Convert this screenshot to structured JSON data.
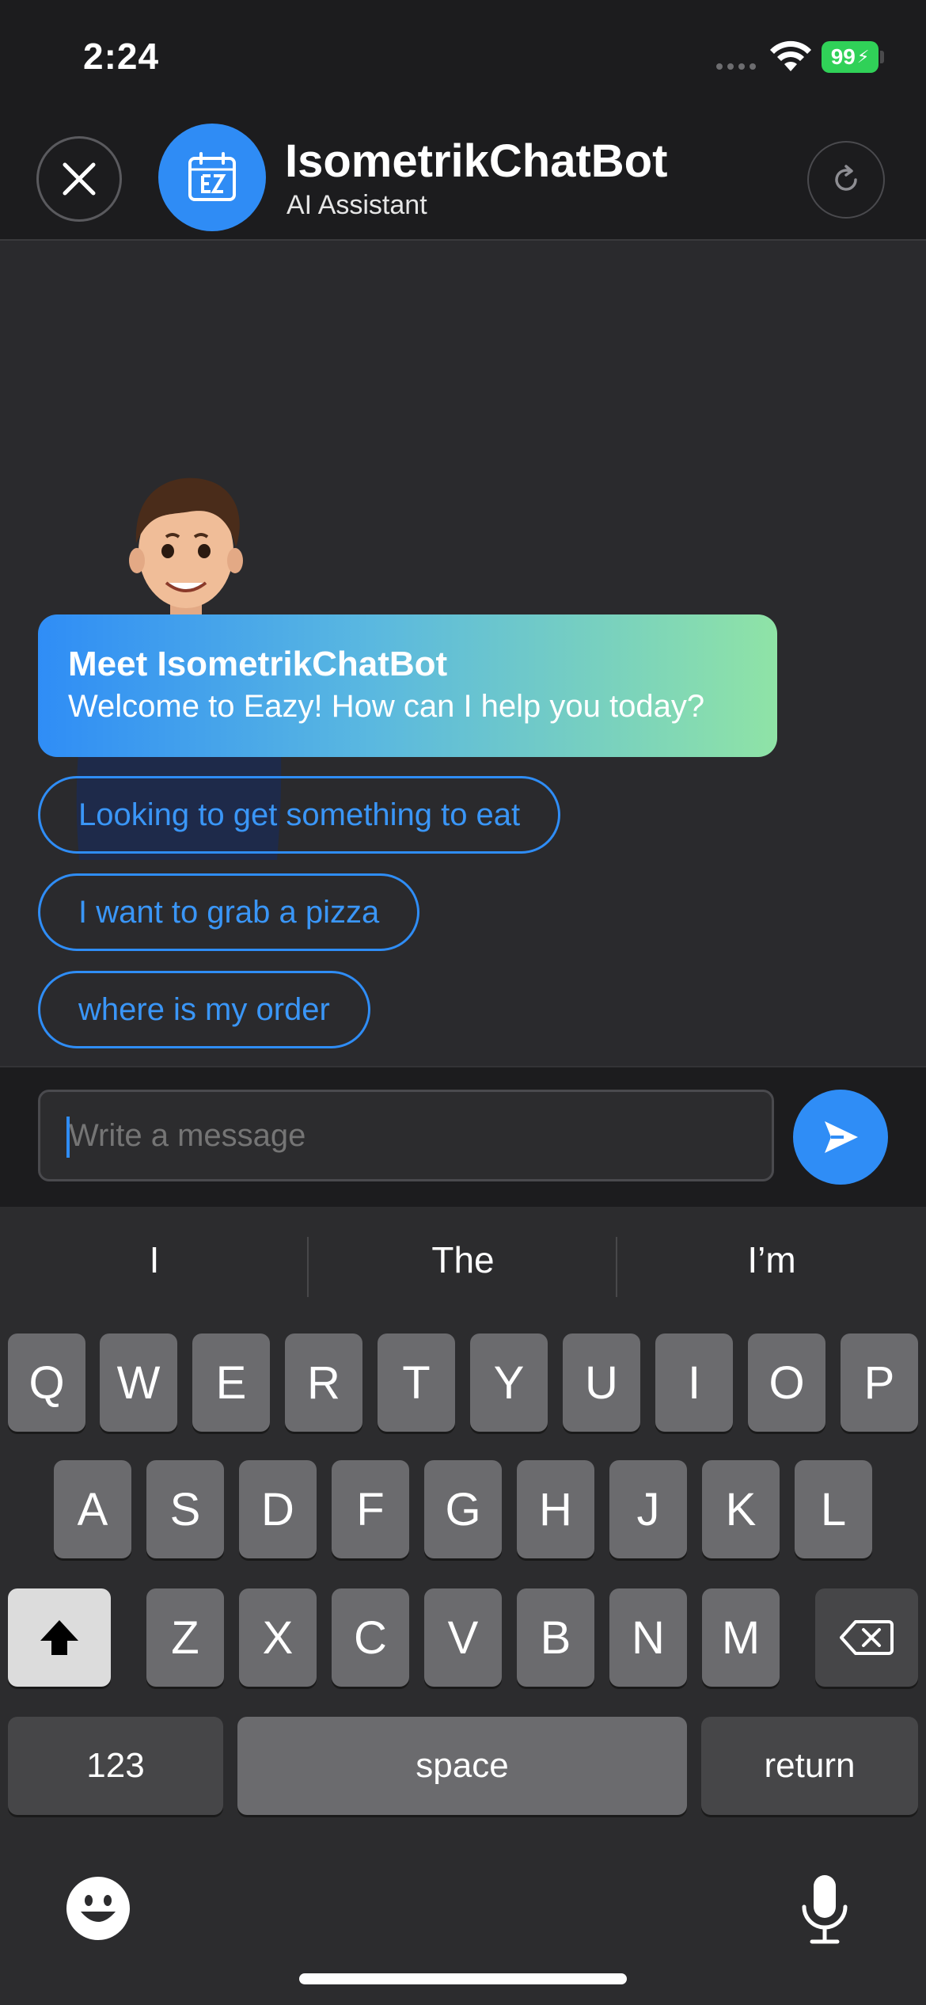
{
  "status": {
    "time": "2:24",
    "battery": "99"
  },
  "header": {
    "bot_name": "IsometrikChatBot",
    "bot_subtitle": "AI Assistant",
    "avatar_icon": "calendar-ez-icon"
  },
  "chat": {
    "welcome_title": "Meet IsometrikChatBot",
    "welcome_text": "Welcome to Eazy! How can I help you today?",
    "suggestions": [
      "Looking to get something to eat",
      "I want to grab a pizza",
      "where is my order"
    ]
  },
  "composer": {
    "placeholder": "Write a message"
  },
  "keyboard": {
    "predictions": [
      "I",
      "The",
      "I’m"
    ],
    "row1": [
      "Q",
      "W",
      "E",
      "R",
      "T",
      "Y",
      "U",
      "I",
      "O",
      "P"
    ],
    "row2": [
      "A",
      "S",
      "D",
      "F",
      "G",
      "H",
      "J",
      "K",
      "L"
    ],
    "row3": [
      "Z",
      "X",
      "C",
      "V",
      "B",
      "N",
      "M"
    ],
    "numbers_label": "123",
    "space_label": "space",
    "return_label": "return"
  },
  "colors": {
    "accent": "#2f8df6",
    "background": "#2a2a2d",
    "bar": "#1c1c1e",
    "battery": "#30d158"
  }
}
